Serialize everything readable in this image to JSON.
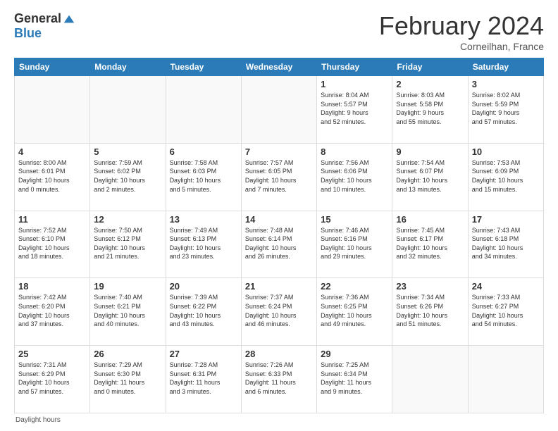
{
  "header": {
    "logo_general": "General",
    "logo_blue": "Blue",
    "title": "February 2024",
    "location": "Corneilhan, France"
  },
  "days_of_week": [
    "Sunday",
    "Monday",
    "Tuesday",
    "Wednesday",
    "Thursday",
    "Friday",
    "Saturday"
  ],
  "weeks": [
    [
      {
        "day": "",
        "info": ""
      },
      {
        "day": "",
        "info": ""
      },
      {
        "day": "",
        "info": ""
      },
      {
        "day": "",
        "info": ""
      },
      {
        "day": "1",
        "info": "Sunrise: 8:04 AM\nSunset: 5:57 PM\nDaylight: 9 hours\nand 52 minutes."
      },
      {
        "day": "2",
        "info": "Sunrise: 8:03 AM\nSunset: 5:58 PM\nDaylight: 9 hours\nand 55 minutes."
      },
      {
        "day": "3",
        "info": "Sunrise: 8:02 AM\nSunset: 5:59 PM\nDaylight: 9 hours\nand 57 minutes."
      }
    ],
    [
      {
        "day": "4",
        "info": "Sunrise: 8:00 AM\nSunset: 6:01 PM\nDaylight: 10 hours\nand 0 minutes."
      },
      {
        "day": "5",
        "info": "Sunrise: 7:59 AM\nSunset: 6:02 PM\nDaylight: 10 hours\nand 2 minutes."
      },
      {
        "day": "6",
        "info": "Sunrise: 7:58 AM\nSunset: 6:03 PM\nDaylight: 10 hours\nand 5 minutes."
      },
      {
        "day": "7",
        "info": "Sunrise: 7:57 AM\nSunset: 6:05 PM\nDaylight: 10 hours\nand 7 minutes."
      },
      {
        "day": "8",
        "info": "Sunrise: 7:56 AM\nSunset: 6:06 PM\nDaylight: 10 hours\nand 10 minutes."
      },
      {
        "day": "9",
        "info": "Sunrise: 7:54 AM\nSunset: 6:07 PM\nDaylight: 10 hours\nand 13 minutes."
      },
      {
        "day": "10",
        "info": "Sunrise: 7:53 AM\nSunset: 6:09 PM\nDaylight: 10 hours\nand 15 minutes."
      }
    ],
    [
      {
        "day": "11",
        "info": "Sunrise: 7:52 AM\nSunset: 6:10 PM\nDaylight: 10 hours\nand 18 minutes."
      },
      {
        "day": "12",
        "info": "Sunrise: 7:50 AM\nSunset: 6:12 PM\nDaylight: 10 hours\nand 21 minutes."
      },
      {
        "day": "13",
        "info": "Sunrise: 7:49 AM\nSunset: 6:13 PM\nDaylight: 10 hours\nand 23 minutes."
      },
      {
        "day": "14",
        "info": "Sunrise: 7:48 AM\nSunset: 6:14 PM\nDaylight: 10 hours\nand 26 minutes."
      },
      {
        "day": "15",
        "info": "Sunrise: 7:46 AM\nSunset: 6:16 PM\nDaylight: 10 hours\nand 29 minutes."
      },
      {
        "day": "16",
        "info": "Sunrise: 7:45 AM\nSunset: 6:17 PM\nDaylight: 10 hours\nand 32 minutes."
      },
      {
        "day": "17",
        "info": "Sunrise: 7:43 AM\nSunset: 6:18 PM\nDaylight: 10 hours\nand 34 minutes."
      }
    ],
    [
      {
        "day": "18",
        "info": "Sunrise: 7:42 AM\nSunset: 6:20 PM\nDaylight: 10 hours\nand 37 minutes."
      },
      {
        "day": "19",
        "info": "Sunrise: 7:40 AM\nSunset: 6:21 PM\nDaylight: 10 hours\nand 40 minutes."
      },
      {
        "day": "20",
        "info": "Sunrise: 7:39 AM\nSunset: 6:22 PM\nDaylight: 10 hours\nand 43 minutes."
      },
      {
        "day": "21",
        "info": "Sunrise: 7:37 AM\nSunset: 6:24 PM\nDaylight: 10 hours\nand 46 minutes."
      },
      {
        "day": "22",
        "info": "Sunrise: 7:36 AM\nSunset: 6:25 PM\nDaylight: 10 hours\nand 49 minutes."
      },
      {
        "day": "23",
        "info": "Sunrise: 7:34 AM\nSunset: 6:26 PM\nDaylight: 10 hours\nand 51 minutes."
      },
      {
        "day": "24",
        "info": "Sunrise: 7:33 AM\nSunset: 6:27 PM\nDaylight: 10 hours\nand 54 minutes."
      }
    ],
    [
      {
        "day": "25",
        "info": "Sunrise: 7:31 AM\nSunset: 6:29 PM\nDaylight: 10 hours\nand 57 minutes."
      },
      {
        "day": "26",
        "info": "Sunrise: 7:29 AM\nSunset: 6:30 PM\nDaylight: 11 hours\nand 0 minutes."
      },
      {
        "day": "27",
        "info": "Sunrise: 7:28 AM\nSunset: 6:31 PM\nDaylight: 11 hours\nand 3 minutes."
      },
      {
        "day": "28",
        "info": "Sunrise: 7:26 AM\nSunset: 6:33 PM\nDaylight: 11 hours\nand 6 minutes."
      },
      {
        "day": "29",
        "info": "Sunrise: 7:25 AM\nSunset: 6:34 PM\nDaylight: 11 hours\nand 9 minutes."
      },
      {
        "day": "",
        "info": ""
      },
      {
        "day": "",
        "info": ""
      }
    ]
  ],
  "footer": {
    "daylight_label": "Daylight hours"
  }
}
